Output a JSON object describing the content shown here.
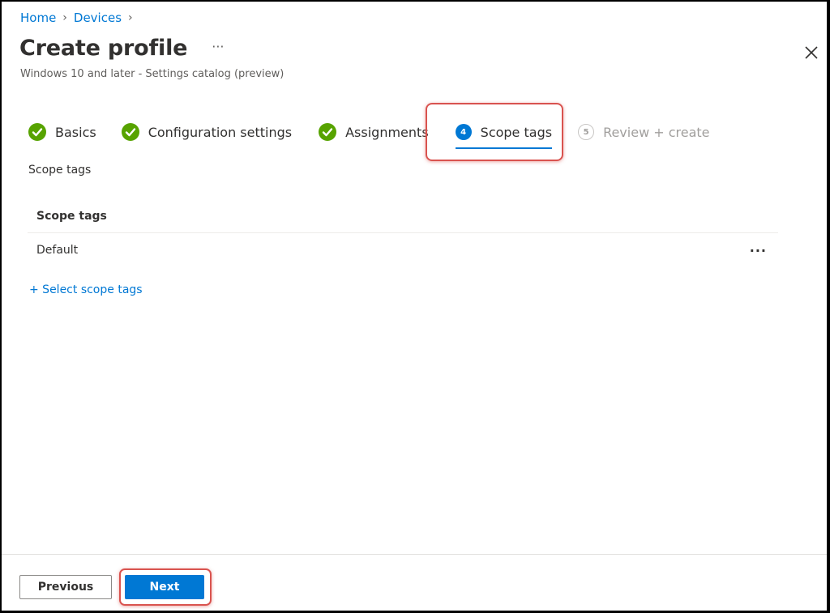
{
  "breadcrumb": [
    {
      "label": "Home"
    },
    {
      "label": "Devices"
    }
  ],
  "header": {
    "title": "Create profile",
    "more_label": "···",
    "subtitle": "Windows 10 and later - Settings catalog (preview)",
    "close_icon": "close-icon"
  },
  "wizard": {
    "steps": [
      {
        "label": "Basics",
        "state": "completed",
        "icon": "check-circle-icon"
      },
      {
        "label": "Configuration settings",
        "state": "completed",
        "icon": "check-circle-icon"
      },
      {
        "label": "Assignments",
        "state": "completed",
        "icon": "check-circle-icon"
      },
      {
        "label": "Scope tags",
        "state": "active",
        "number": "4"
      },
      {
        "label": "Review + create",
        "state": "pending",
        "number": "5"
      }
    ]
  },
  "content": {
    "section_label": "Scope tags",
    "table": {
      "header": "Scope tags",
      "rows": [
        {
          "name": "Default",
          "more_label": "···"
        }
      ]
    },
    "add_link": "+ Select scope tags"
  },
  "footer": {
    "previous_label": "Previous",
    "next_label": "Next"
  },
  "colors": {
    "accent": "#0078d4",
    "success": "#57a300",
    "highlight": "#d9534f"
  }
}
